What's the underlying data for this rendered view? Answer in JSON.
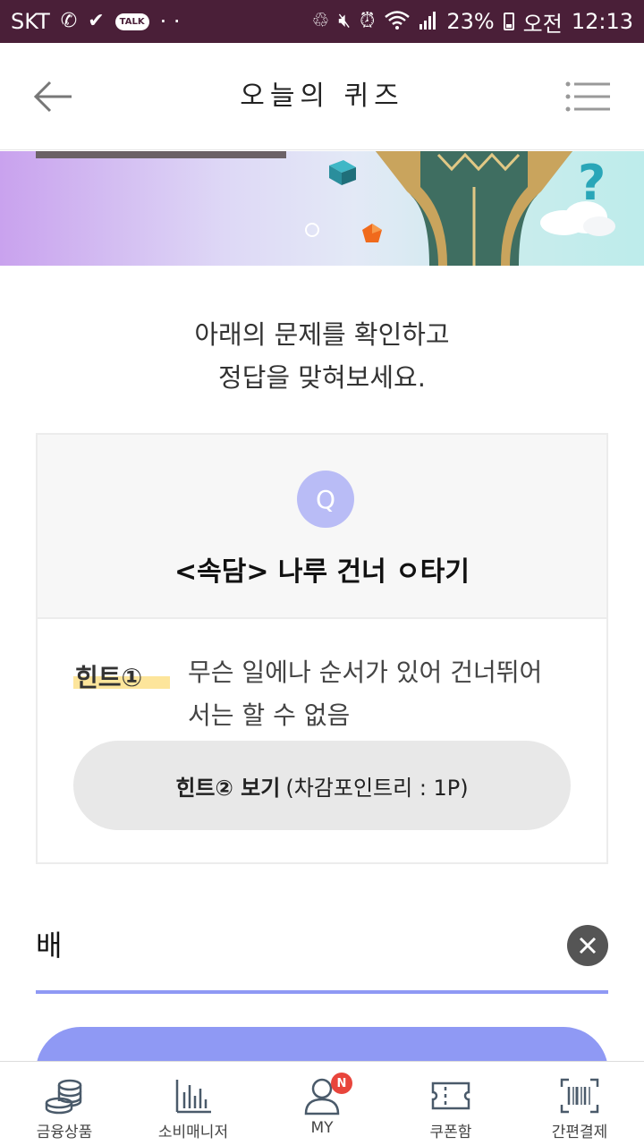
{
  "status_bar": {
    "carrier": "SKT",
    "battery": "23%",
    "ampm": "오전",
    "time": "12:13",
    "talk_badge": "TALK",
    "dots": "· ·"
  },
  "header": {
    "title": "오늘의 퀴즈",
    "back_icon": "arrow-left-icon",
    "menu_icon": "hamburger-menu-icon"
  },
  "instruction": {
    "line1": "아래의 문제를 확인하고",
    "line2": "정답을 맞혀보세요."
  },
  "quiz": {
    "badge": "Q",
    "question": "<속담> 나루 건너 ㅇ타기",
    "hint1_label": "힌트①",
    "hint1_text": "무슨 일에나 순서가 있어 건너뛰어 서는 할 수 없음",
    "hint2_button_bold": "힌트② 보기",
    "hint2_button_sub": "(차감포인트리 : 1P)"
  },
  "answer": {
    "value": "배"
  },
  "bottom_nav": {
    "items": [
      {
        "label": "금융상품",
        "icon": "coins-icon"
      },
      {
        "label": "소비매니저",
        "icon": "bar-chart-icon"
      },
      {
        "label": "MY",
        "icon": "user-icon",
        "badge": "N"
      },
      {
        "label": "쿠폰함",
        "icon": "ticket-icon"
      },
      {
        "label": "간편결제",
        "icon": "barcode-icon"
      }
    ]
  },
  "colors": {
    "status_bar": "#4a1f38",
    "accent": "#8f99f4",
    "q_badge": "#b9bcf6",
    "highlight": "#fde08a",
    "badge_red": "#e8453c"
  }
}
